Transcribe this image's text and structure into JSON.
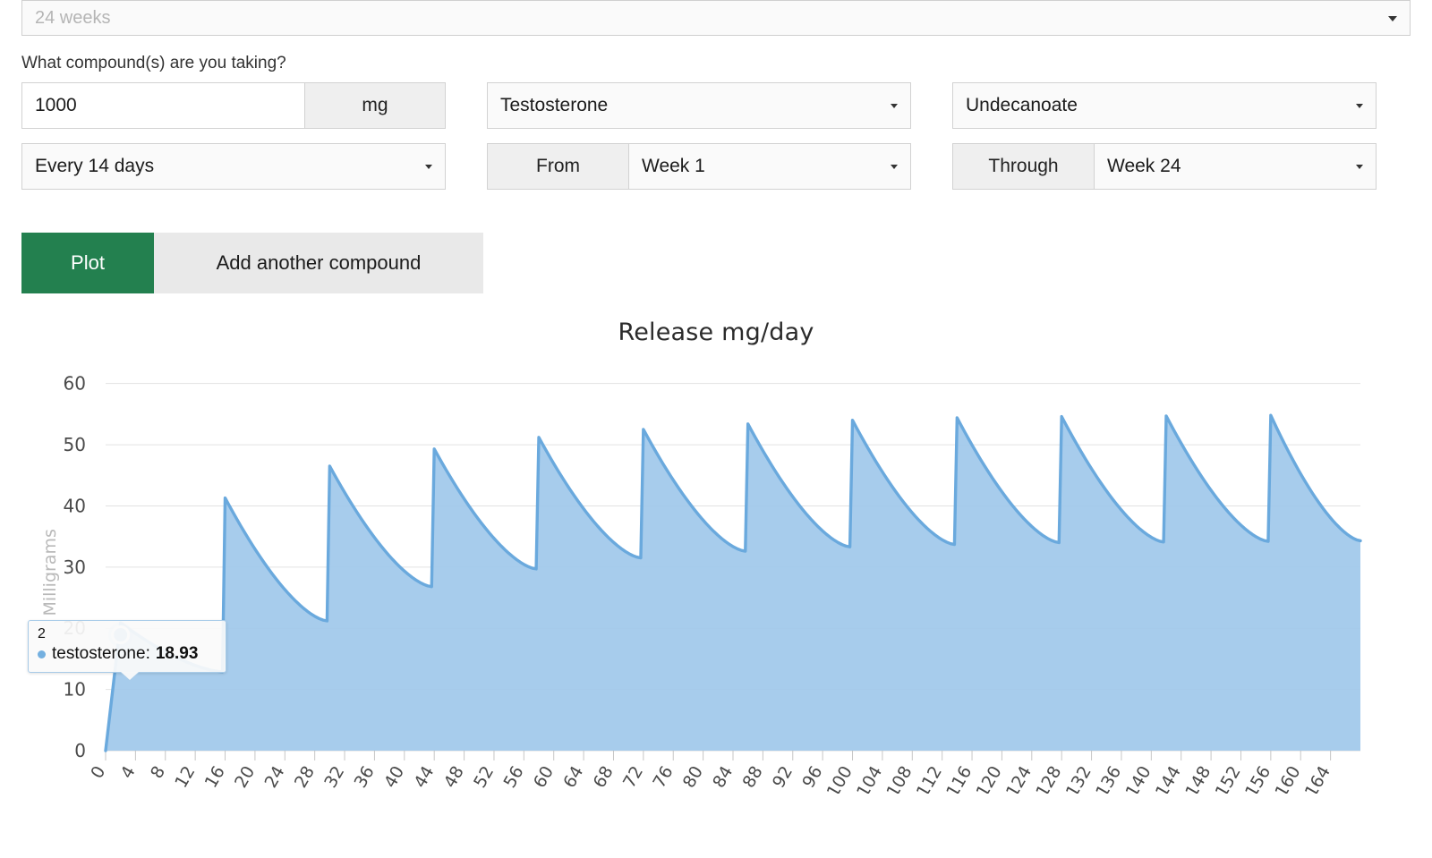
{
  "form": {
    "duration_select": {
      "value": "24 weeks",
      "caret": "chevron-down-icon"
    },
    "question_label": "What compound(s) are you taking?",
    "dose": {
      "value": "1000",
      "unit": "mg"
    },
    "compound": "Testosterone",
    "ester": "Undecanoate",
    "frequency": "Every 14 days",
    "from_label": "From",
    "from_week": "Week 1",
    "through_label": "Through",
    "through_week": "Week 24"
  },
  "buttons": {
    "plot": "Plot",
    "add_compound": "Add another compound",
    "plot_color": "#23804f",
    "add_color": "#e9e9e9"
  },
  "tooltip": {
    "header": "2",
    "series": "testosterone:",
    "value": "18.93",
    "dot_color": "#74b0e0"
  },
  "chart_data": {
    "type": "area",
    "title": "Release mg/day",
    "xlabel": "",
    "ylabel": "Milligrams",
    "ylim": [
      0,
      62
    ],
    "yticks": [
      0,
      10,
      20,
      30,
      40,
      50,
      60
    ],
    "xlim": [
      0,
      168
    ],
    "xticks": [
      0,
      4,
      8,
      12,
      16,
      20,
      24,
      28,
      32,
      36,
      40,
      44,
      48,
      52,
      56,
      60,
      64,
      68,
      72,
      76,
      80,
      84,
      88,
      92,
      96,
      100,
      104,
      108,
      112,
      116,
      120,
      124,
      128,
      132,
      136,
      140,
      144,
      148,
      152,
      156,
      160,
      164
    ],
    "grid": true,
    "legend": "none",
    "line_color": "#6aa9dd",
    "fill_color": "#9fc8ea",
    "dose_interval_days": 14,
    "series": [
      {
        "name": "testosterone",
        "peaks": [
          20.9,
          41.3,
          46.5,
          49.3,
          51.2,
          52.5,
          53.4,
          54.0,
          54.4,
          54.6,
          54.7,
          54.8
        ],
        "troughs": [
          12.9,
          21.2,
          26.8,
          29.7,
          31.5,
          32.6,
          33.3,
          33.7,
          34.0,
          34.1,
          34.2,
          34.3
        ],
        "peak_days": [
          2,
          16,
          30,
          44,
          58,
          72,
          86,
          100,
          114,
          128,
          142,
          156
        ],
        "highlight_point": {
          "x": 2,
          "y": 18.93
        }
      }
    ]
  }
}
